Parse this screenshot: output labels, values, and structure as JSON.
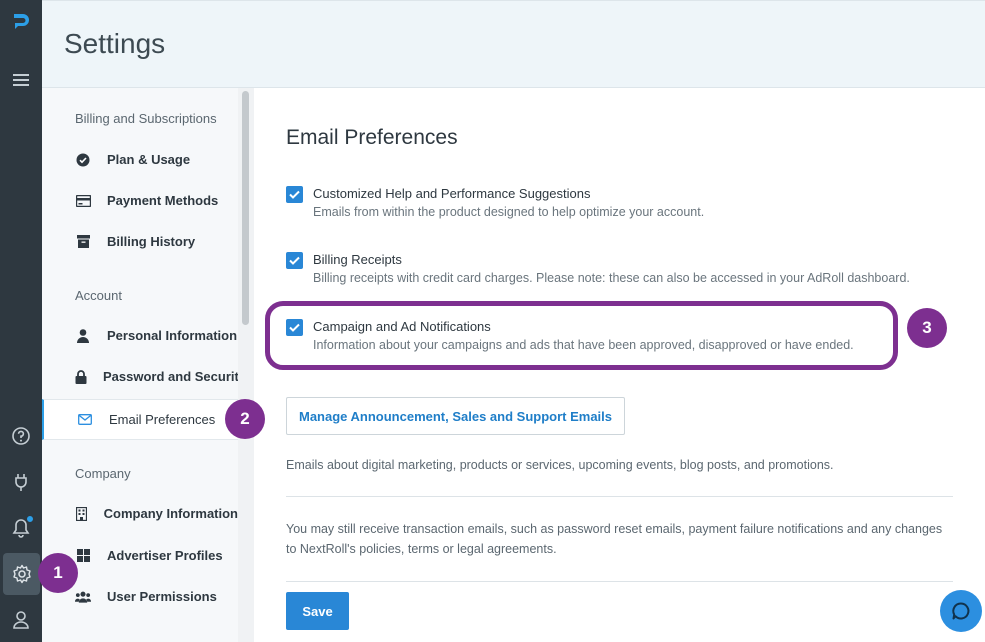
{
  "header": {
    "title": "Settings"
  },
  "nav": {
    "sections": [
      {
        "label": "Billing and Subscriptions"
      },
      {
        "label": "Account"
      },
      {
        "label": "Company"
      }
    ],
    "items": [
      {
        "label": "Plan & Usage",
        "icon": "verified-check-icon"
      },
      {
        "label": "Payment Methods",
        "icon": "credit-card-icon"
      },
      {
        "label": "Billing History",
        "icon": "archive-box-icon"
      },
      {
        "label": "Personal Information",
        "icon": "person-icon"
      },
      {
        "label": "Password and Security",
        "icon": "lock-icon"
      },
      {
        "label": "Email Preferences",
        "icon": "envelope-icon"
      },
      {
        "label": "Company Information",
        "icon": "building-icon"
      },
      {
        "label": "Advertiser Profiles",
        "icon": "grid-icon"
      },
      {
        "label": "User Permissions",
        "icon": "users-icon"
      }
    ]
  },
  "main": {
    "title": "Email Preferences",
    "preferences": [
      {
        "title": "Customized Help and Performance Suggestions",
        "description": "Emails from within the product designed to help optimize your account.",
        "checked": true
      },
      {
        "title": "Billing Receipts",
        "description": "Billing receipts with credit card charges. Please note: these can also be accessed in your AdRoll dashboard.",
        "checked": true
      },
      {
        "title": "Campaign and Ad Notifications",
        "description": "Information about your campaigns and ads that have been approved, disapproved or have ended.",
        "checked": true
      }
    ],
    "manage_button": "Manage Announcement, Sales and Support Emails",
    "info_marketing": "Emails about digital marketing, products or services, upcoming events, blog posts, and promotions.",
    "info_transactional": "You may still receive transaction emails, such as password reset emails, payment failure notifications and any changes to NextRoll's policies, terms or legal agreements.",
    "save_button": "Save"
  },
  "annotations": {
    "step1": "1",
    "step2": "2",
    "step3": "3"
  },
  "colors": {
    "accent": "#2987d6",
    "annotation": "#7d2f90",
    "rail": "#2e3840"
  }
}
